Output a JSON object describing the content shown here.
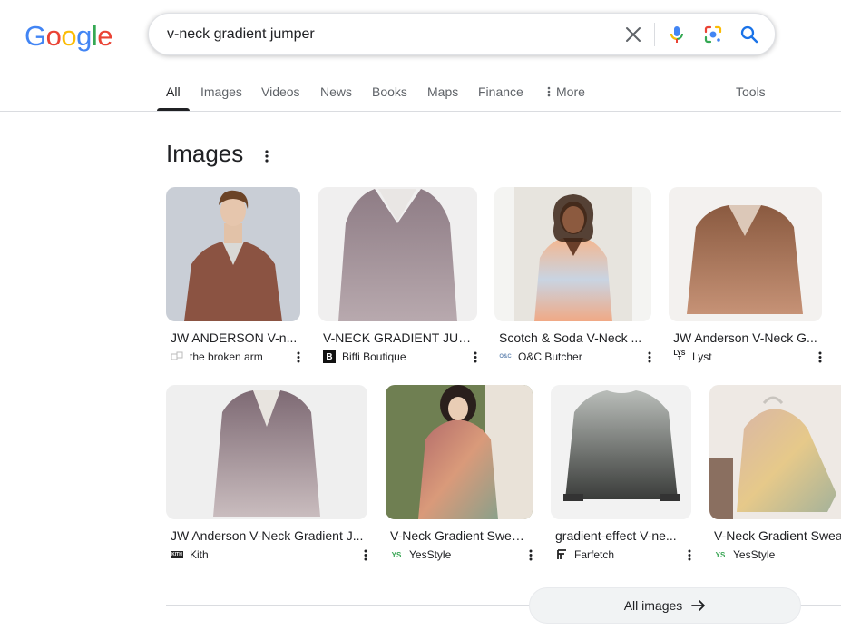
{
  "logo": {
    "letters": [
      "G",
      "o",
      "o",
      "g",
      "l",
      "e"
    ],
    "colors": [
      "#4285F4",
      "#EA4335",
      "#FBBC05",
      "#4285F4",
      "#34A853",
      "#EA4335"
    ]
  },
  "search": {
    "query": "v-neck gradient jumper",
    "placeholder": "Search"
  },
  "tabs": [
    {
      "label": "All",
      "active": true
    },
    {
      "label": "Images"
    },
    {
      "label": "Videos"
    },
    {
      "label": "News"
    },
    {
      "label": "Books"
    },
    {
      "label": "Maps"
    },
    {
      "label": "Finance"
    },
    {
      "label": "More"
    },
    {
      "label": "Tools"
    }
  ],
  "images_section": {
    "title": "Images",
    "row1": [
      {
        "title": "JW ANDERSON V-n...",
        "source": "the broken arm",
        "icon": "broken-arm-logo-icon"
      },
      {
        "title": "V-NECK GRADIENT JUM...",
        "source": "Biffi Boutique",
        "icon": "biffi-logo-icon"
      },
      {
        "title": "Scotch & Soda V-Neck ...",
        "source": "O&C Butcher",
        "icon": "oc-butcher-logo-icon"
      },
      {
        "title": "JW Anderson V-Neck G...",
        "source": "Lyst",
        "icon": "lyst-logo-icon"
      }
    ],
    "row2": [
      {
        "title": "JW Anderson V-Neck Gradient J...",
        "source": "Kith",
        "icon": "kith-logo-icon"
      },
      {
        "title": "V-Neck Gradient Swea...",
        "source": "YesStyle",
        "icon": "yesstyle-logo-icon"
      },
      {
        "title": "gradient-effect V-ne...",
        "source": "Farfetch",
        "icon": "farfetch-logo-icon"
      },
      {
        "title": "V-Neck Gradient Swea",
        "source": "YesStyle",
        "icon": "yesstyle-logo-icon"
      }
    ],
    "all_images_label": "All images"
  },
  "source_icon_text": {
    "lyst": "LYS\nT",
    "kith": "KITH",
    "oc": "O&C",
    "ys": "YS"
  },
  "colors": {
    "accent": "#1a73e8",
    "text": "#202124",
    "muted": "#5f6368",
    "divider": "#dadce0"
  }
}
